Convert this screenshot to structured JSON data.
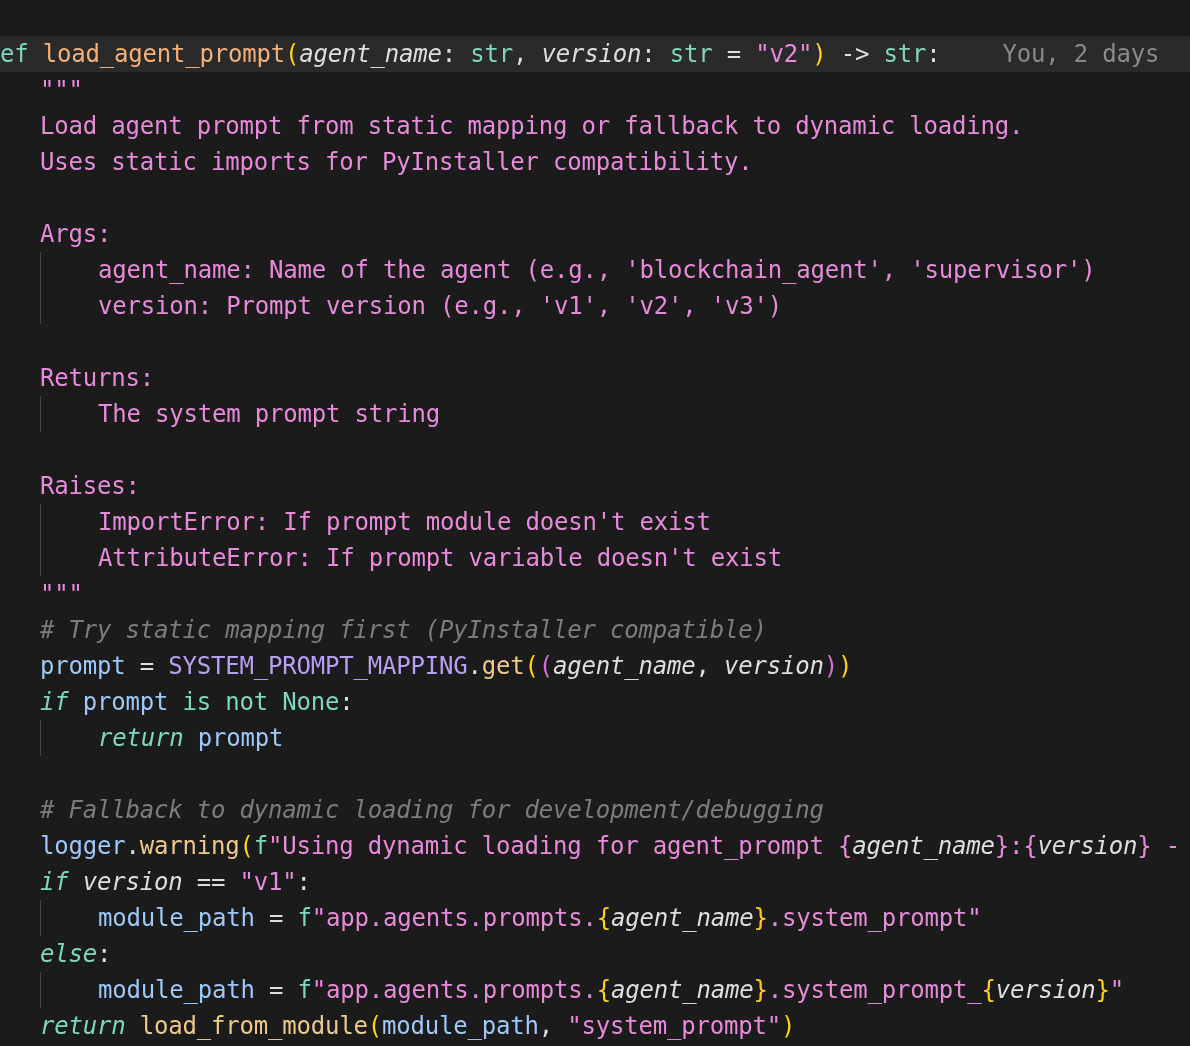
{
  "editor": {
    "lines": [
      {
        "kind": "code",
        "current": true,
        "tokens": [
          {
            "t": "ef ",
            "kind": "kw"
          },
          {
            "t": "load_agent_prompt",
            "kind": "defname"
          },
          {
            "t": "(",
            "kind": "paren"
          },
          {
            "t": "agent_name",
            "kind": "param"
          },
          {
            "t": ": ",
            "kind": "punct"
          },
          {
            "t": "str",
            "kind": "kw"
          },
          {
            "t": ", ",
            "kind": "punct"
          },
          {
            "t": "version",
            "kind": "param"
          },
          {
            "t": ": ",
            "kind": "punct"
          },
          {
            "t": "str",
            "kind": "kw"
          },
          {
            "t": " = ",
            "kind": "punct"
          },
          {
            "t": "\"v2\"",
            "kind": "str"
          },
          {
            "t": ")",
            "kind": "paren"
          },
          {
            "t": " -> ",
            "kind": "punct"
          },
          {
            "t": "str",
            "kind": "kw"
          },
          {
            "t": ":",
            "kind": "punct"
          }
        ],
        "blame": "You, 2 days",
        "children": [
          {
            "kind": "code",
            "current": false,
            "tokens": [
              {
                "t": "\"\"\"",
                "kind": "str"
              }
            ]
          },
          {
            "kind": "code",
            "current": false,
            "tokens": [
              {
                "t": "Load agent prompt from static mapping or fallback to dynamic loading.",
                "kind": "str"
              }
            ]
          },
          {
            "kind": "code",
            "current": false,
            "tokens": [
              {
                "t": "Uses static imports for PyInstaller compatibility.",
                "kind": "str"
              }
            ]
          },
          {
            "kind": "blank"
          },
          {
            "kind": "code",
            "current": false,
            "tokens": [
              {
                "t": "Args:",
                "kind": "str"
              }
            ],
            "children": [
              {
                "kind": "code",
                "current": false,
                "tokens": [
                  {
                    "t": "agent_name: Name of the agent (e.g., 'blockchain_agent', 'supervisor')",
                    "kind": "str"
                  }
                ]
              },
              {
                "kind": "code",
                "current": false,
                "tokens": [
                  {
                    "t": "version: Prompt version (e.g., 'v1', 'v2', 'v3')",
                    "kind": "str"
                  }
                ]
              }
            ]
          },
          {
            "kind": "blank"
          },
          {
            "kind": "code",
            "current": false,
            "tokens": [
              {
                "t": "Returns:",
                "kind": "str"
              }
            ],
            "children": [
              {
                "kind": "code",
                "current": false,
                "tokens": [
                  {
                    "t": "The system prompt string",
                    "kind": "str"
                  }
                ]
              }
            ]
          },
          {
            "kind": "blank"
          },
          {
            "kind": "code",
            "current": false,
            "tokens": [
              {
                "t": "Raises:",
                "kind": "str"
              }
            ],
            "children": [
              {
                "kind": "code",
                "current": false,
                "tokens": [
                  {
                    "t": "ImportError: If prompt module doesn't exist",
                    "kind": "str"
                  }
                ]
              },
              {
                "kind": "code",
                "current": false,
                "tokens": [
                  {
                    "t": "AttributeError: If prompt variable doesn't exist",
                    "kind": "str"
                  }
                ]
              }
            ]
          },
          {
            "kind": "code",
            "current": false,
            "tokens": [
              {
                "t": "\"\"\"",
                "kind": "str"
              }
            ]
          },
          {
            "kind": "code",
            "current": false,
            "tokens": [
              {
                "t": "# Try static mapping first (PyInstaller compatible)",
                "kind": "comment"
              }
            ]
          },
          {
            "kind": "code",
            "current": false,
            "tokens": [
              {
                "t": "prompt",
                "kind": "var"
              },
              {
                "t": " = ",
                "kind": "punct"
              },
              {
                "t": "SYSTEM_PROMPT_MAPPING",
                "kind": "const"
              },
              {
                "t": ".",
                "kind": "punct"
              },
              {
                "t": "get",
                "kind": "fn"
              },
              {
                "t": "(",
                "kind": "paren"
              },
              {
                "t": "(",
                "kind": "paren2"
              },
              {
                "t": "agent_name",
                "kind": "param"
              },
              {
                "t": ", ",
                "kind": "punct"
              },
              {
                "t": "version",
                "kind": "param"
              },
              {
                "t": ")",
                "kind": "paren2"
              },
              {
                "t": ")",
                "kind": "paren"
              }
            ]
          },
          {
            "kind": "code",
            "current": false,
            "tokens": [
              {
                "t": "if ",
                "kind": "kwi"
              },
              {
                "t": "prompt",
                "kind": "var"
              },
              {
                "t": " is not None",
                "kind": "kw"
              },
              {
                "t": ":",
                "kind": "punct"
              }
            ],
            "children": [
              {
                "kind": "code",
                "current": false,
                "tokens": [
                  {
                    "t": "return ",
                    "kind": "kwi"
                  },
                  {
                    "t": "prompt",
                    "kind": "var"
                  }
                ]
              }
            ]
          },
          {
            "kind": "blank"
          },
          {
            "kind": "code",
            "current": false,
            "tokens": [
              {
                "t": "# Fallback to dynamic loading for development/debugging",
                "kind": "comment"
              }
            ]
          },
          {
            "kind": "code",
            "current": false,
            "tokens": [
              {
                "t": "logger",
                "kind": "var"
              },
              {
                "t": ".",
                "kind": "punct"
              },
              {
                "t": "warning",
                "kind": "fn"
              },
              {
                "t": "(",
                "kind": "paren"
              },
              {
                "t": "f",
                "kind": "kw"
              },
              {
                "t": "\"Using dynamic loading for agent_prompt {",
                "kind": "str"
              },
              {
                "t": "agent_name",
                "kind": "param"
              },
              {
                "t": "}:{",
                "kind": "str"
              },
              {
                "t": "version",
                "kind": "param"
              },
              {
                "t": "} -",
                "kind": "str"
              }
            ]
          },
          {
            "kind": "code",
            "current": false,
            "tokens": [
              {
                "t": "if ",
                "kind": "kwi"
              },
              {
                "t": "version",
                "kind": "param"
              },
              {
                "t": " == ",
                "kind": "punct"
              },
              {
                "t": "\"v1\"",
                "kind": "str"
              },
              {
                "t": ":",
                "kind": "punct"
              }
            ],
            "children": [
              {
                "kind": "code",
                "current": false,
                "tokens": [
                  {
                    "t": "module_path",
                    "kind": "var"
                  },
                  {
                    "t": " = ",
                    "kind": "punct"
                  },
                  {
                    "t": "f",
                    "kind": "kw"
                  },
                  {
                    "t": "\"app.agents.prompts.",
                    "kind": "str"
                  },
                  {
                    "t": "{",
                    "kind": "paren"
                  },
                  {
                    "t": "agent_name",
                    "kind": "param"
                  },
                  {
                    "t": "}",
                    "kind": "paren"
                  },
                  {
                    "t": ".system_prompt\"",
                    "kind": "str"
                  }
                ]
              }
            ]
          },
          {
            "kind": "code",
            "current": false,
            "tokens": [
              {
                "t": "else",
                "kind": "kwi"
              },
              {
                "t": ":",
                "kind": "punct"
              }
            ],
            "children": [
              {
                "kind": "code",
                "current": false,
                "tokens": [
                  {
                    "t": "module_path",
                    "kind": "var"
                  },
                  {
                    "t": " = ",
                    "kind": "punct"
                  },
                  {
                    "t": "f",
                    "kind": "kw"
                  },
                  {
                    "t": "\"app.agents.prompts.",
                    "kind": "str"
                  },
                  {
                    "t": "{",
                    "kind": "paren"
                  },
                  {
                    "t": "agent_name",
                    "kind": "param"
                  },
                  {
                    "t": "}",
                    "kind": "paren"
                  },
                  {
                    "t": ".system_prompt_",
                    "kind": "str"
                  },
                  {
                    "t": "{",
                    "kind": "paren"
                  },
                  {
                    "t": "version",
                    "kind": "param"
                  },
                  {
                    "t": "}",
                    "kind": "paren"
                  },
                  {
                    "t": "\"",
                    "kind": "str"
                  }
                ]
              }
            ]
          },
          {
            "kind": "code",
            "current": false,
            "tokens": [
              {
                "t": "return ",
                "kind": "kwi"
              },
              {
                "t": "load_from_module",
                "kind": "fn"
              },
              {
                "t": "(",
                "kind": "paren"
              },
              {
                "t": "module_path",
                "kind": "var"
              },
              {
                "t": ", ",
                "kind": "punct"
              },
              {
                "t": "\"system_prompt\"",
                "kind": "str"
              },
              {
                "t": ")",
                "kind": "paren"
              }
            ]
          }
        ]
      }
    ]
  }
}
